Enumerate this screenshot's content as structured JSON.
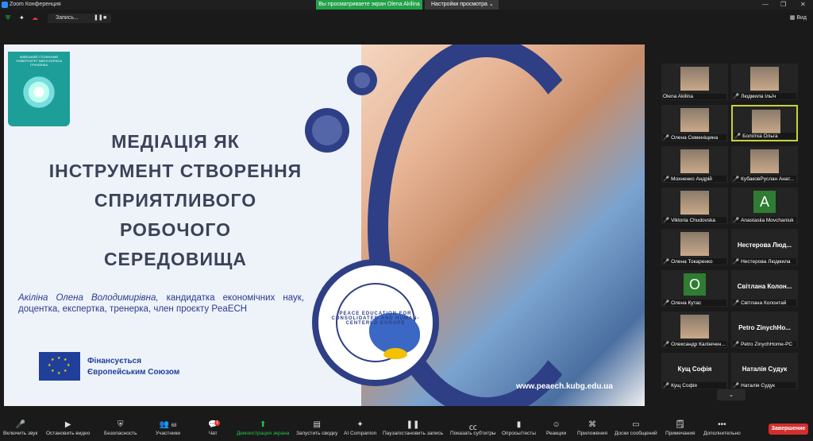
{
  "window": {
    "title": "Zoom Конференция"
  },
  "banner": {
    "sharing": "Вы просматриваете экран Olena Akilina",
    "view_options": "Настройки просмотра"
  },
  "topbar": {
    "recording": "Запись...",
    "view": "Вид"
  },
  "slide": {
    "university": "КИЇВСЬКИЙ СТОЛИЧНИЙ УНІВЕРСИТЕТ ІМЕНІ БОРИСА ГРІНЧЕНКА",
    "title_lines": [
      "МЕДІАЦІЯ ЯК",
      "ІНСТРУМЕНТ СТВОРЕННЯ",
      "СПРИЯТЛИВОГО",
      "РОБОЧОГО",
      "СЕРЕДОВИЩА"
    ],
    "author_name": "Акіліна Олена Володимирівна,",
    "author_desc": " кандидатка економічних наук, доцентка, експертка, тренерка, член проєкту PeaECH",
    "eu_line1": "Фінансується",
    "eu_line2": "Європейським Союзом",
    "peace_text": "PEACE EDUCATION FOR CONSOLIDATED AND HUMAN-CENTERED EUROPE",
    "url": "www.peaech.kubg.edu.ua"
  },
  "participants": [
    {
      "name": "Olena Akilina",
      "big": "",
      "type": "video",
      "muted": false
    },
    {
      "name": "Людмила Ільїч",
      "big": "",
      "type": "video",
      "muted": true
    },
    {
      "name": "Олена Семеніщина",
      "big": "",
      "type": "video",
      "muted": true
    },
    {
      "name": "Болотка Ольга",
      "big": "",
      "type": "video",
      "muted": true,
      "active": true
    },
    {
      "name": "Мохненко Андрій",
      "big": "",
      "type": "video",
      "muted": true
    },
    {
      "name": "КубаковРуслан Анат...",
      "big": "",
      "type": "video",
      "muted": true
    },
    {
      "name": "Viktoria Chudovska",
      "big": "",
      "type": "video",
      "muted": true
    },
    {
      "name": "Anastasiia Movchaniuk",
      "big": "",
      "type": "avatar",
      "letter": "A",
      "muted": true
    },
    {
      "name": "Олена Токаренко",
      "big": "",
      "type": "video",
      "muted": true
    },
    {
      "name": "Нестерова Людмила",
      "big": "Нестерова Люд...",
      "type": "text",
      "muted": true
    },
    {
      "name": "Олена Кутас",
      "big": "",
      "type": "avatar",
      "letter": "O",
      "muted": true
    },
    {
      "name": "Світлана Колонтай",
      "big": "Світлана Колон...",
      "type": "text",
      "muted": true
    },
    {
      "name": "Олександр Калінічен...",
      "big": "",
      "type": "video",
      "muted": true
    },
    {
      "name": "Petro ZinychHome-PC",
      "big": "Petro ZinychHo...",
      "type": "text",
      "muted": true
    },
    {
      "name": "Кущ Софія",
      "big": "Кущ Софія",
      "type": "text",
      "muted": true
    },
    {
      "name": "Наталія Судук",
      "big": "Наталія Судук",
      "type": "text",
      "muted": true
    }
  ],
  "toolbar": {
    "unmute": "Включить звук",
    "stop_video": "Остановить видео",
    "security": "Безопасность",
    "participants": "Участники",
    "participants_count": "68",
    "chat": "Чат",
    "chat_badge": "1",
    "share": "Демонстрация экрана",
    "summary": "Запустить сводку",
    "ai": "AI Companion",
    "pause_rec": "Пауза/остановить запись",
    "captions": "Показать субтитры",
    "polls": "Опросы/тесты",
    "reactions": "Реакции",
    "apps": "Приложения",
    "whiteboards": "Доски сообщений",
    "notes": "Примечания",
    "more": "Дополнительно",
    "end": "Завершение"
  }
}
